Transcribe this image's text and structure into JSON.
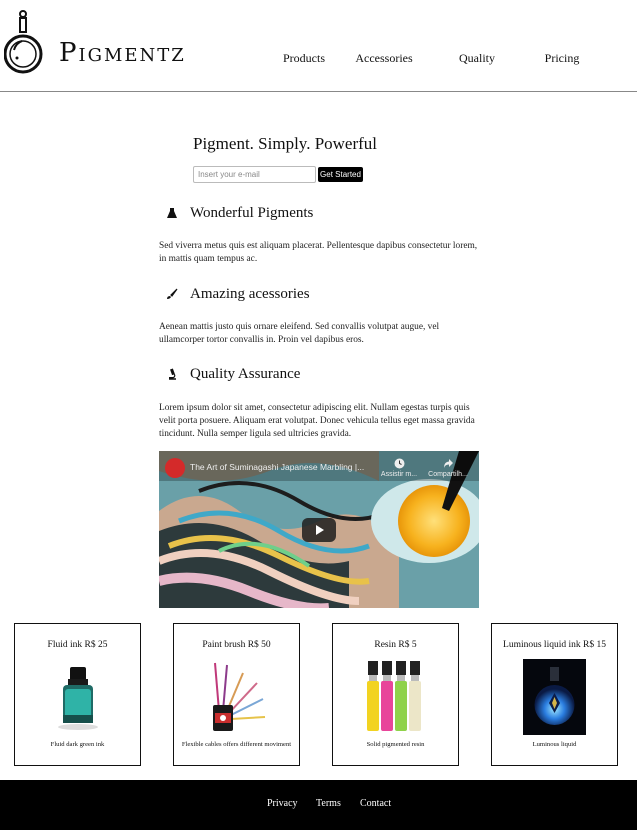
{
  "brand": {
    "name": "Pigmentz",
    "logo_icon": "flask-icon"
  },
  "nav": {
    "items": [
      "Products",
      "Accessories",
      "Quality",
      "Pricing"
    ]
  },
  "hero": {
    "title": "Pigment. Simply. Powerful",
    "email_placeholder": "Insert your e-mail",
    "cta_label": "Get Started"
  },
  "sections": [
    {
      "icon": "flask-icon",
      "title": "Wonderful Pigments",
      "body": "Sed viverra metus quis est aliquam placerat. Pellentesque dapibus consectetur lorem, in mattis quam tempus ac."
    },
    {
      "icon": "paint-brush-icon",
      "title": "Amazing acessories",
      "body": "Aenean mattis justo quis ornare eleifend. Sed convallis volutpat augue, vel ullamcorper tortor convallis in. Proin vel dapibus eros."
    },
    {
      "icon": "microscope-icon",
      "title": "Quality Assurance",
      "body": "Lorem ipsum dolor sit amet, consectetur adipiscing elit. Nullam egestas turpis quis velit porta posuere. Aliquam erat volutpat. Donec vehicula tellus eget massa gravida tincidunt. Nulla semper ligula sed ultricies gravida."
    }
  ],
  "video": {
    "title": "The Art of Suminagashi Japanese Marbling |...",
    "watch_later": "Assistir m...",
    "share": "Compartilh..."
  },
  "products": [
    {
      "title": "Fluid ink R$ 25",
      "desc": "Fluid dark green ink"
    },
    {
      "title": "Paint brush R$ 50",
      "desc": "Flexible cables offers different moviment"
    },
    {
      "title": "Resin R$ 5",
      "desc": "Solid pigmented resin"
    },
    {
      "title": "Luminous liquid ink R$ 15",
      "desc": "Luminous liquid"
    }
  ],
  "footer": {
    "links": [
      "Privacy",
      "Terms",
      "Contact"
    ]
  },
  "colors": {
    "footer_bg": "#000000",
    "accent": "#000000",
    "youtube_red": "#d42a2a"
  }
}
